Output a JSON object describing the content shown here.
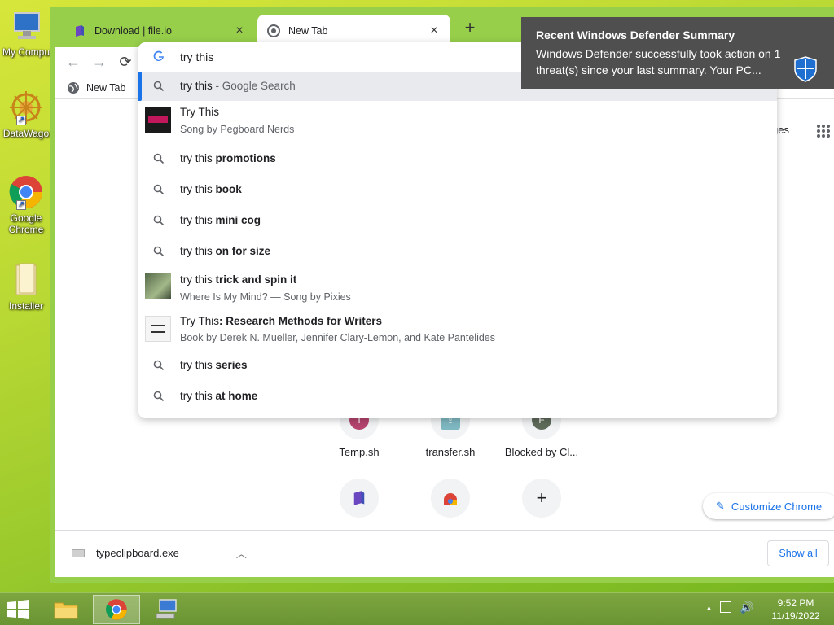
{
  "desktop": {
    "icons": [
      {
        "label": "My Compu"
      },
      {
        "label": "DataWago"
      },
      {
        "label": "Google Chrome"
      },
      {
        "label": "Installer"
      }
    ]
  },
  "browser": {
    "tabs": [
      {
        "title": "Download | file.io",
        "active": false
      },
      {
        "title": "New Tab",
        "active": true
      }
    ],
    "omnibox_text": "try this",
    "bookmarks": [
      {
        "label": "New Tab"
      }
    ],
    "images_link": "ges"
  },
  "suggestions": [
    {
      "main": "try this",
      "bold": "",
      "suffix": " - Google Search",
      "type": "search",
      "selected": true
    },
    {
      "main": "Try This",
      "bold": "",
      "sub": "Song by Pegboard Nerds",
      "type": "entity"
    },
    {
      "main": "try this ",
      "bold": "promotions",
      "type": "search"
    },
    {
      "main": "try this ",
      "bold": "book",
      "type": "search"
    },
    {
      "main": "try this ",
      "bold": "mini cog",
      "type": "search"
    },
    {
      "main": "try this ",
      "bold": "on for size",
      "type": "search"
    },
    {
      "main": "try this ",
      "bold": "trick and spin it",
      "sub": "Where Is My Mind? — Song by Pixies",
      "type": "entity"
    },
    {
      "main": "Try This",
      "bold": ": Research Methods for Writers",
      "sub": "Book by Derek N. Mueller, Jennifer Clary-Lemon, and Kate Pantelides",
      "type": "entity"
    },
    {
      "main": "try this ",
      "bold": "series",
      "type": "search"
    },
    {
      "main": "try this ",
      "bold": "at home",
      "type": "search"
    }
  ],
  "shortcuts": [
    {
      "label": "Temp.sh",
      "initial": "T",
      "color": "#b5446e"
    },
    {
      "label": "transfer.sh",
      "initial": "",
      "color": "#7fb8c2"
    },
    {
      "label": "Blocked by Cl...",
      "initial": "F",
      "color": "#5f6b5a"
    }
  ],
  "customize_label": "Customize Chrome",
  "download": {
    "filename": "typeclipboard.exe",
    "show_all": "Show all"
  },
  "notification": {
    "title": "Recent Windows Defender Summary",
    "body": "Windows Defender successfully took action on 1 threat(s) since your last summary. Your PC..."
  },
  "taskbar": {
    "time": "9:52 PM",
    "date": "11/19/2022"
  },
  "colors": {
    "accent": "#1a73e8",
    "window_frame": "#97cf4b",
    "toast_bg": "#4f4f4f"
  }
}
